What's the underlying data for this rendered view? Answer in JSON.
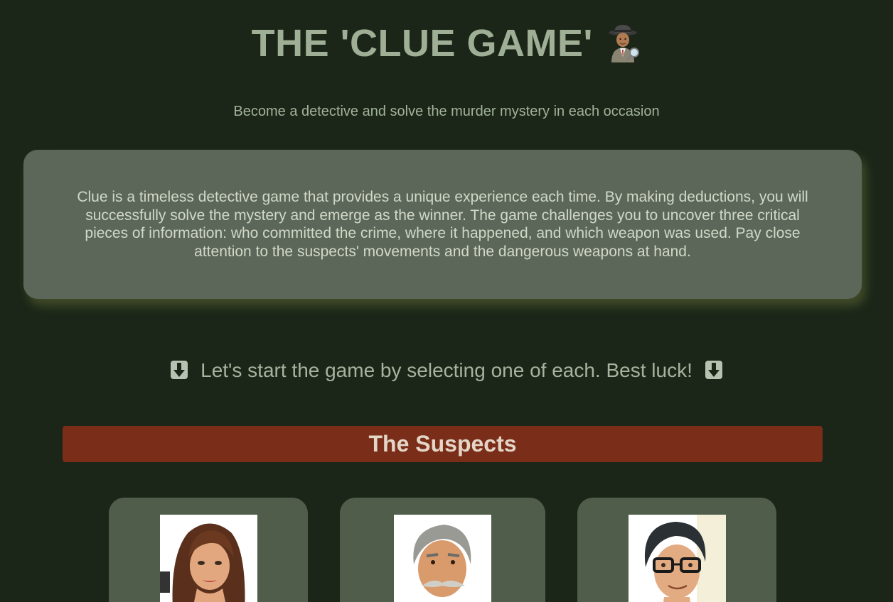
{
  "header": {
    "title": "THE 'CLUE GAME'",
    "title_icon": "detective-icon",
    "subtitle": "Become a detective and solve the murder mystery in each occasion"
  },
  "intro": {
    "text": "Clue is a timeless detective game that provides a unique experience each time. By making deductions, you will successfully solve the mystery and emerge as the winner. The game challenges you to uncover three critical pieces of information: who committed the crime, where it happened, and which weapon was used. Pay close attention to the suspects' movements and the dangerous weapons at hand."
  },
  "prompt": {
    "text": "Let's start the game by selecting one of each. Best luck!",
    "icon": "down-arrow-icon"
  },
  "sections": {
    "suspects": {
      "heading": "The Suspects",
      "cards": [
        {
          "portrait": "woman-portrait-image"
        },
        {
          "portrait": "mustached-man-portrait-image"
        },
        {
          "portrait": "glasses-man-portrait-image"
        }
      ]
    }
  },
  "colors": {
    "background": "#1b2618",
    "title": "#9eaf95",
    "intro_card": "#5d6759",
    "section_bar": "#7a2d19",
    "suspect_card": "#4f5d4a"
  }
}
